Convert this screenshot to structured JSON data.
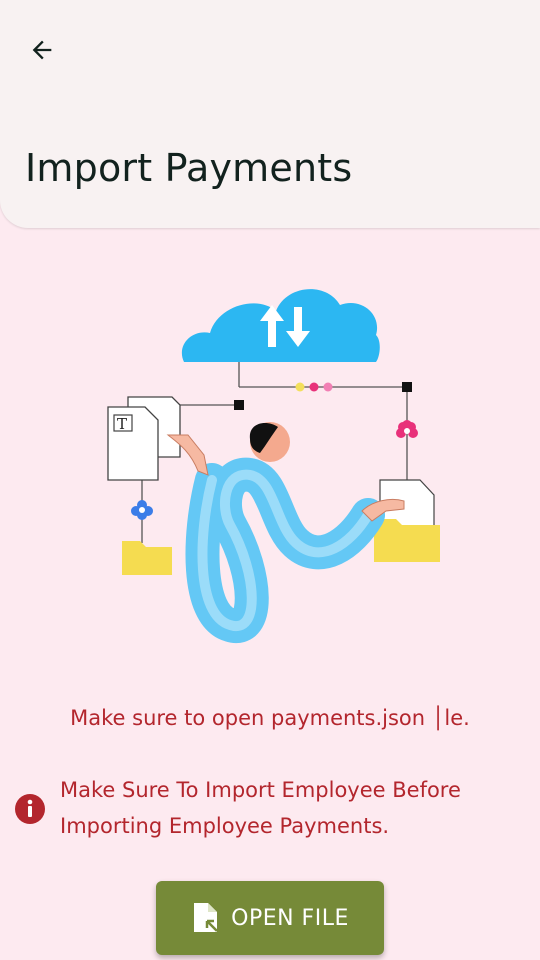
{
  "header": {
    "back_icon": "arrow-left-icon",
    "title": "Import Payments"
  },
  "illustration": {
    "name": "cloud-file-transfer-illustration",
    "file_doc_letter": "T"
  },
  "message": {
    "note": "Make sure to open payments.json │le.",
    "warning_icon": "info-icon",
    "warning": "Make Sure To Import Employee Before Importing Employee Payments."
  },
  "actions": {
    "open_file_icon": "file-open-icon",
    "open_file_label": "OPEN FILE"
  },
  "colors": {
    "background": "#fdeaf0",
    "app_bar": "#f8f2f2",
    "error_text": "#b3262d",
    "button": "#768a38"
  }
}
